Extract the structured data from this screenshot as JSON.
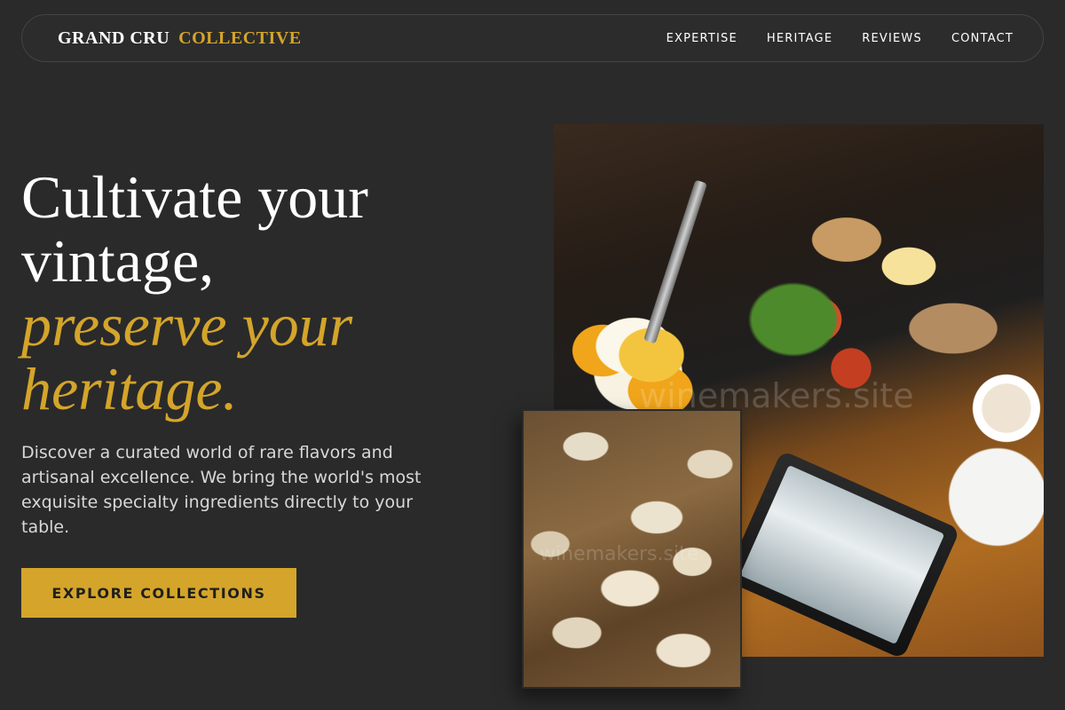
{
  "nav": {
    "brand_part1": "GRAND CRU",
    "brand_part2": "COLLECTIVE",
    "links": [
      "EXPERTISE",
      "HERITAGE",
      "REVIEWS",
      "CONTACT"
    ]
  },
  "hero": {
    "title_line1": "Cultivate your vintage,",
    "title_line2": "preserve your heritage.",
    "description": "Discover a curated world of rare flavors and artisanal excellence. We bring the world's most exquisite specialty ingredients directly to your table.",
    "cta_label": "EXPLORE COLLECTIONS"
  },
  "watermark": "winemakers.site",
  "colors": {
    "background": "#2a2a2a",
    "accent": "#d4a52a"
  }
}
